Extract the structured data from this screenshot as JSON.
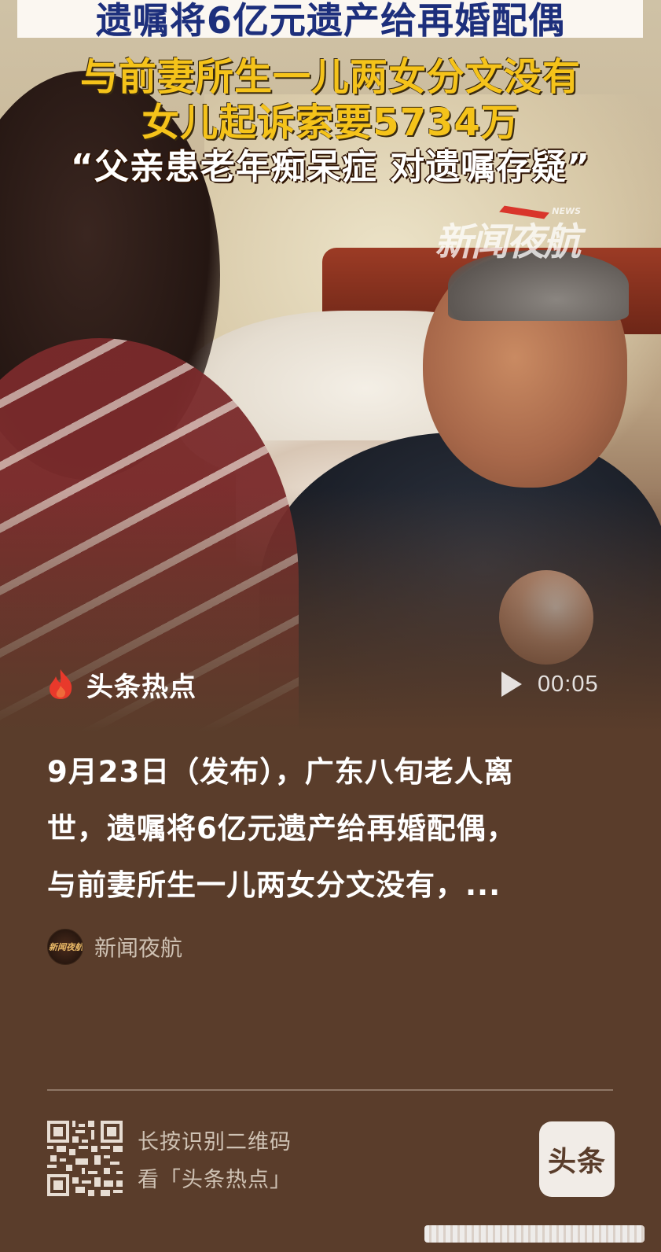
{
  "video": {
    "caption_line1": "遗嘱将6亿元遗产给再婚配偶",
    "caption_line2": "与前妻所生一儿两女分文没有",
    "caption_line3": "女儿起诉索要5734万",
    "caption_line4": "“父亲患老年痴呆症 对遗嘱存疑”",
    "watermark": "新闻夜航",
    "watermark_sub": "NEWS",
    "brand_label": "头条热点",
    "duration": "00:05"
  },
  "article": {
    "description_line1": "9月23日（发布），广东八旬老人离",
    "description_line2": "世，遗嘱将6亿元遗产给再婚配偶，",
    "description_line3": "与前妻所生一儿两女分文没有，...",
    "source_name": "新闻夜航",
    "source_avatar_text": "新闻夜航"
  },
  "footer": {
    "qr_hint_line1": "长按识别二维码",
    "qr_hint_line2": "看「头条热点」",
    "app_logo_text": "头条"
  },
  "colors": {
    "background": "#5a3d2b",
    "caption_blue": "#1d2f7c",
    "caption_yellow": "#f5c31a",
    "flame_red": "#e8392b"
  },
  "icons": {
    "brand": "flame-icon",
    "play": "play-icon",
    "qr": "qr-code-icon",
    "app": "toutiao-logo-icon"
  }
}
